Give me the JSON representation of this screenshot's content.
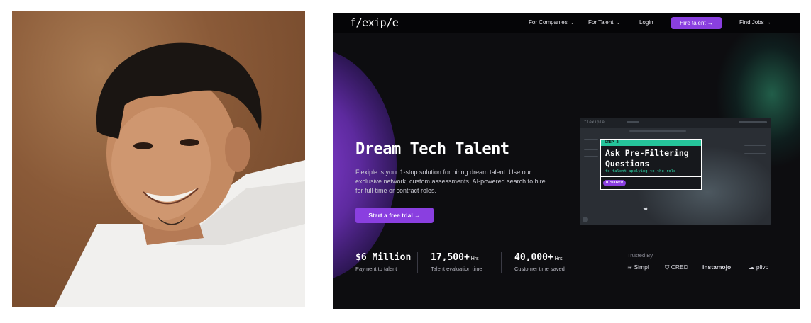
{
  "nav": {
    "logo": "f/exip/e",
    "for_companies": "For Companies",
    "for_talent": "For Talent",
    "login": "Login",
    "hire_talent": "Hire talent  →",
    "find_jobs": "Find Jobs →"
  },
  "hero": {
    "title": "Dream Tech Talent",
    "description": "Flexiple is your 1-stop solution for hiring dream talent. Use our exclusive network, custom assessments, AI-powered search to hire for full-time or contract roles.",
    "cta": "Start a free trial  →"
  },
  "preview": {
    "app_logo": "flexiple",
    "step": "STEP 2",
    "title": "Ask Pre-Filtering Questions",
    "subtitle": "to talent applying to the role",
    "badge": "DISCOVER"
  },
  "stats": [
    {
      "value": "$6 Million",
      "unit": "",
      "label": "Payment to talent"
    },
    {
      "value": "17,500+",
      "unit": "Hrs",
      "label": "Talent evaluation time"
    },
    {
      "value": "40,000+",
      "unit": "Hrs",
      "label": "Customer time saved"
    }
  ],
  "trusted": {
    "label": "Trusted By",
    "brands": [
      "Simpl",
      "CRED",
      "instamojo",
      "plivo"
    ]
  },
  "colors": {
    "accent_purple": "#8a3fe0",
    "accent_green": "#25c49a",
    "background": "#0d0d10"
  }
}
